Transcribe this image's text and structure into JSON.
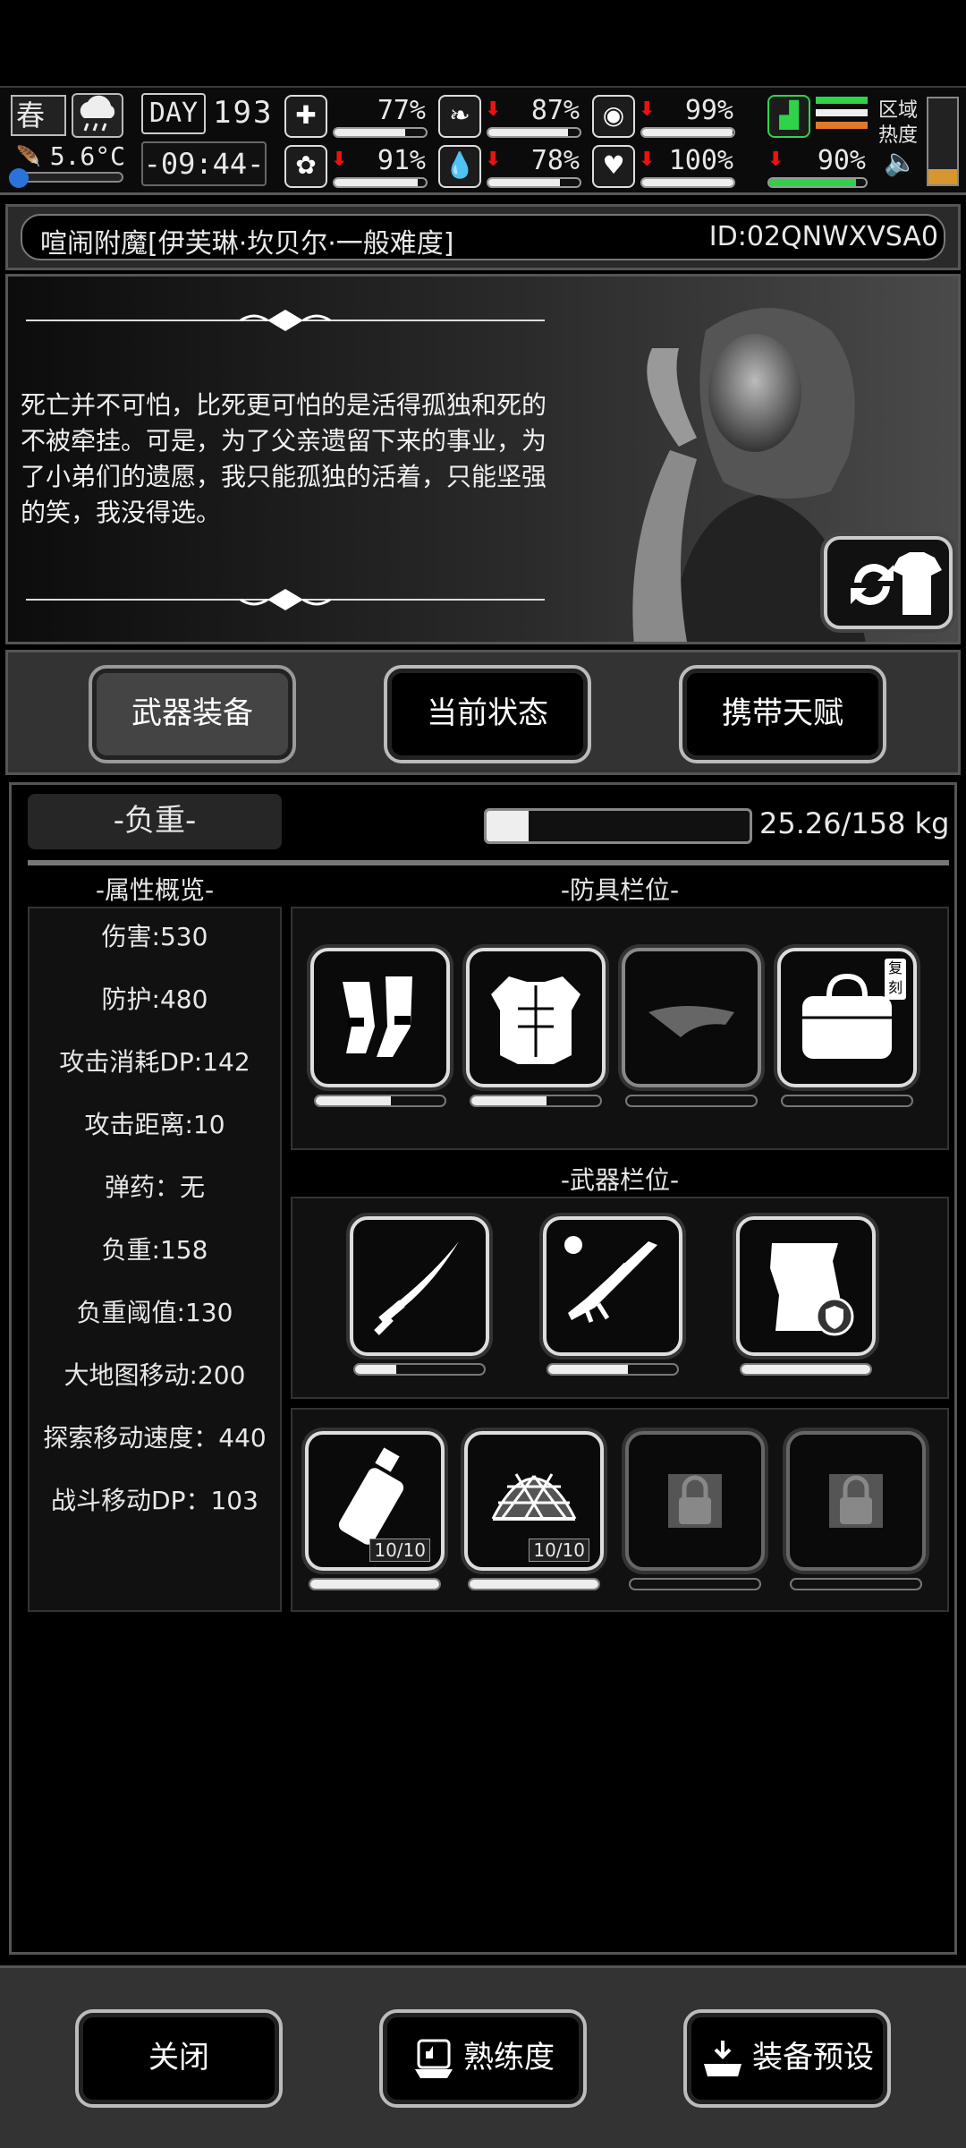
{
  "status": {
    "season": "春",
    "temperature": "5.6°C",
    "day_label": "DAY",
    "day": "193",
    "time": "-09:44-",
    "stats": [
      {
        "icon": "medkit-icon",
        "value": "77%",
        "fill": 0.77,
        "down": false
      },
      {
        "icon": "stomach-icon",
        "value": "87%",
        "fill": 0.87,
        "down": true
      },
      {
        "icon": "mood-icon",
        "value": "99%",
        "fill": 0.99,
        "down": true
      },
      {
        "icon": "brain-icon",
        "value": "91%",
        "fill": 0.91,
        "down": true
      },
      {
        "icon": "water-drop-icon",
        "value": "78%",
        "fill": 0.78,
        "down": true
      },
      {
        "icon": "heart-icon",
        "value": "100%",
        "fill": 1.0,
        "down": true
      }
    ],
    "stamina": {
      "icon": "boot-icon",
      "value": "90%",
      "fill": 0.9,
      "down": true
    },
    "region_label_1": "区域",
    "region_label_2": "热度",
    "region_heat": 0.18
  },
  "title": {
    "name": "喧闹附魔[伊芙琳·坎贝尔·一般难度]",
    "id": "ID:02QNWXVSA0"
  },
  "quote": "死亡并不可怕，比死更可怕的是活得孤独和死的不被牵挂。可是，为了父亲遗留下来的事业，为了小弟们的遗愿，我只能孤独的活着，只能坚强的笑，我没得选。",
  "tabs": [
    "武器装备",
    "当前状态",
    "携带天赋"
  ],
  "load": {
    "label": "-负重-",
    "text": "25.26/158 kg",
    "fill": 0.16
  },
  "attr_head": "-属性概览-",
  "attrs": [
    "伤害:530",
    "防护:480",
    "攻击消耗DP:142",
    "攻击距离:10",
    "弹药：无",
    "负重:158",
    "负重阈值:130",
    "大地图移动:200",
    "探索移动速度：440",
    "战斗移动DP：103"
  ],
  "armor_head": "-防具栏位-",
  "weapon_head": "-武器栏位-",
  "armor_slots": [
    {
      "icon": "gauntlets-icon",
      "durability": 0.58
    },
    {
      "icon": "chest-armor-icon",
      "durability": 0.58
    },
    {
      "icon": "visor-cap-icon",
      "durability": 0.0
    },
    {
      "icon": "bag-icon",
      "durability": 0.0,
      "tag": "复刻"
    }
  ],
  "weapon_slots": [
    {
      "icon": "katana-icon",
      "durability": 0.32
    },
    {
      "icon": "sniper-rifle-icon",
      "durability": 0.62
    },
    {
      "icon": "shield-plate-icon",
      "durability": 1.0
    }
  ],
  "item_slots": [
    {
      "icon": "water-bottle-icon",
      "count": "10/10",
      "durability": 1.0
    },
    {
      "icon": "net-icon",
      "count": "10/10",
      "durability": 1.0
    },
    {
      "icon": "lock-icon",
      "durability": 0.0
    },
    {
      "icon": "lock-icon",
      "durability": 0.0
    }
  ],
  "footer": {
    "close": "关闭",
    "proficiency": "熟练度",
    "preset": "装备预设"
  }
}
